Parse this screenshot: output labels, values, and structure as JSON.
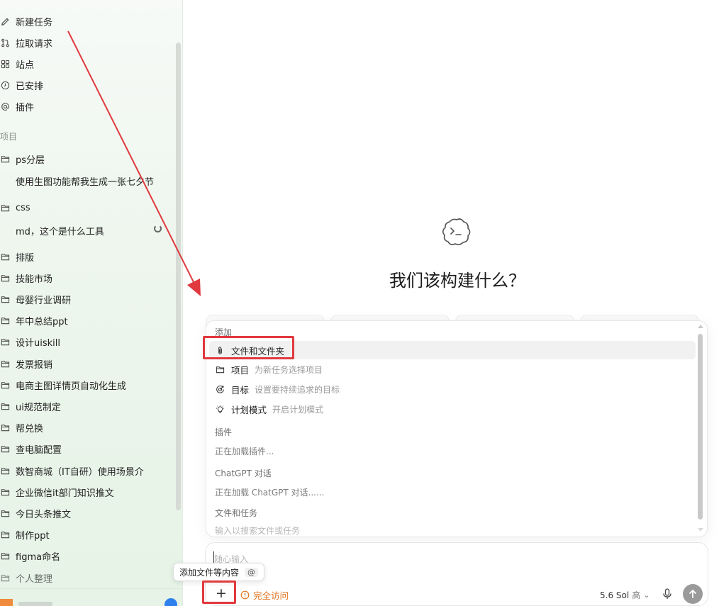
{
  "sidebar": {
    "nav": [
      {
        "label": "新建任务",
        "icon": "edit-icon"
      },
      {
        "label": "拉取请求",
        "icon": "pull-request-icon"
      },
      {
        "label": "站点",
        "icon": "sites-icon"
      },
      {
        "label": "已安排",
        "icon": "clock-icon"
      },
      {
        "label": "插件",
        "icon": "at-icon"
      }
    ],
    "projects_header": "项目",
    "projects": [
      {
        "label": "ps分层",
        "sub": "使用生图功能帮我生成一张七夕节"
      },
      {
        "label": "css",
        "sub": "md，这个是什么工具"
      },
      {
        "label": "排版"
      },
      {
        "label": "技能市场"
      },
      {
        "label": "母婴行业调研"
      },
      {
        "label": "年中总结ppt"
      },
      {
        "label": "设计uiskill"
      },
      {
        "label": "发票报销"
      },
      {
        "label": "电商主图详情页自动化生成"
      },
      {
        "label": "ui规范制定"
      },
      {
        "label": "帮兑换"
      },
      {
        "label": "查电脑配置"
      },
      {
        "label": "数智商城（IT自研）使用场景介"
      },
      {
        "label": "企业微信it部门知识推文"
      },
      {
        "label": "今日头条推文"
      },
      {
        "label": "制作ppt"
      },
      {
        "label": "figma命名"
      },
      {
        "label": "个人整理"
      }
    ]
  },
  "main": {
    "headline": "我们该构建什么？"
  },
  "menu": {
    "add_header": "添加",
    "items": [
      {
        "label": "文件和文件夹",
        "desc": "",
        "icon": "paperclip-icon"
      },
      {
        "label": "项目",
        "desc": "为新任务选择项目",
        "icon": "folder-icon"
      },
      {
        "label": "目标",
        "desc": "设置要持续追求的目标",
        "icon": "target-icon"
      },
      {
        "label": "计划模式",
        "desc": "开启计划模式",
        "icon": "lightbulb-icon"
      }
    ],
    "plugins_header": "插件",
    "plugins_loading": "正在加载插件...",
    "chatgpt_header": "ChatGPT 对话",
    "chatgpt_loading": "正在加载 ChatGPT 对话......",
    "files_header": "文件和任务",
    "files_hint": "输入以搜索文件或任务"
  },
  "composer": {
    "placeholder": "随心输入",
    "tooltip": "添加文件等内容",
    "tooltip_key": "@",
    "plus": "+",
    "access": "完全访问",
    "model": "5.6 Sol",
    "effort": "高",
    "colors": {
      "access": "#e0731f",
      "highlight": "#e0393e"
    }
  }
}
